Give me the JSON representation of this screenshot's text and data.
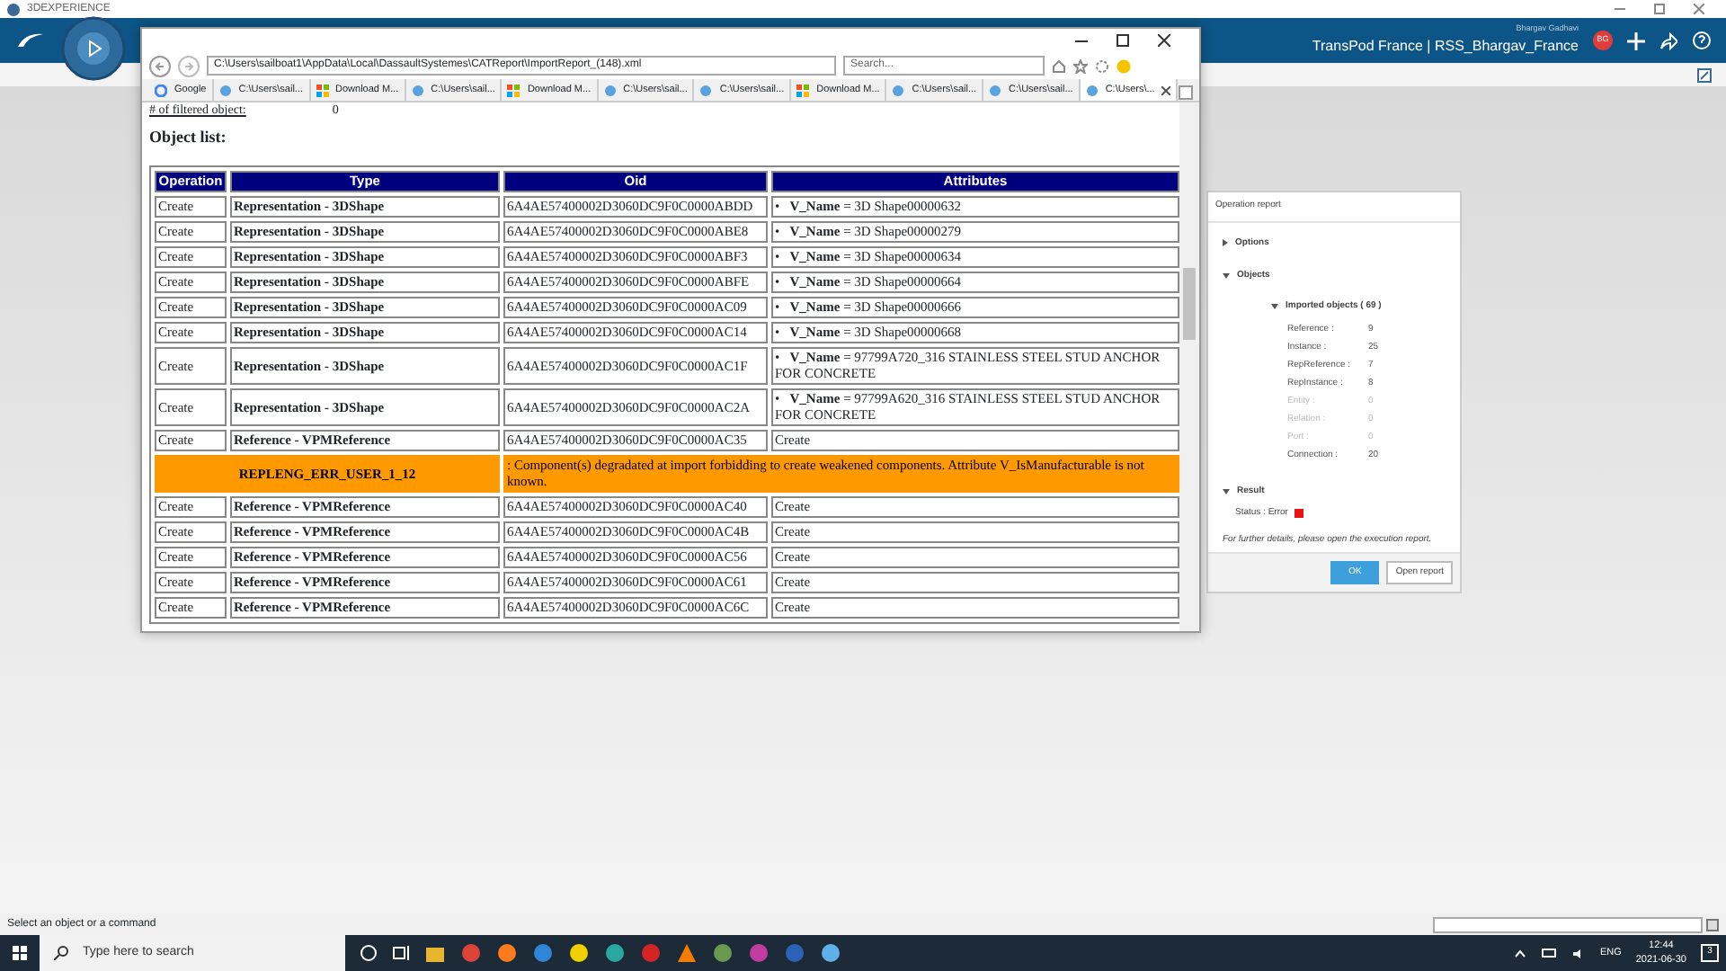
{
  "app_window": {
    "title": "3DEXPERIENCE"
  },
  "header": {
    "user_name": "Bhargav Gadhavi",
    "context": "TransPod France | RSS_Bhargav_France",
    "avatar_initials": "BG"
  },
  "browser": {
    "address": "C:\\Users\\sailboat1\\AppData\\Local\\DassaultSystemes\\CATReport\\ImportReport_(148).xml",
    "search_placeholder": "Search...",
    "tabs": [
      {
        "label": "Google",
        "kind": "google",
        "selected": false
      },
      {
        "label": "C:\\Users\\sail...",
        "kind": "ie",
        "selected": false
      },
      {
        "label": "Download M...",
        "kind": "ms",
        "selected": false
      },
      {
        "label": "C:\\Users\\sail...",
        "kind": "ie",
        "selected": false
      },
      {
        "label": "Download M...",
        "kind": "ms",
        "selected": false
      },
      {
        "label": "C:\\Users\\sail...",
        "kind": "ie",
        "selected": false
      },
      {
        "label": "C:\\Users\\sail...",
        "kind": "ie",
        "selected": false
      },
      {
        "label": "Download M...",
        "kind": "ms",
        "selected": false
      },
      {
        "label": "C:\\Users\\sail...",
        "kind": "ie",
        "selected": false
      },
      {
        "label": "C:\\Users\\sail...",
        "kind": "ie",
        "selected": false
      },
      {
        "label": "C:\\Users\\...",
        "kind": "ie",
        "selected": true
      }
    ],
    "page": {
      "filtered_label": "# of filtered object:",
      "filtered_value": "0",
      "heading": "Object list:",
      "columns": [
        "Operation",
        "Type",
        "Oid",
        "Attributes"
      ],
      "rows": [
        {
          "kind": "item",
          "operation": "Create",
          "type": "Representation - 3DShape",
          "oid": "6A4AE57400002D3060DC9F0C0000ABDD",
          "attributes": "•   **V_Name** = 3D Shape00000632"
        },
        {
          "kind": "item",
          "operation": "Create",
          "type": "Representation - 3DShape",
          "oid": "6A4AE57400002D3060DC9F0C0000ABE8",
          "attributes": "•   **V_Name** = 3D Shape00000279"
        },
        {
          "kind": "item",
          "operation": "Create",
          "type": "Representation - 3DShape",
          "oid": "6A4AE57400002D3060DC9F0C0000ABF3",
          "attributes": "•   **V_Name** = 3D Shape00000634"
        },
        {
          "kind": "item",
          "operation": "Create",
          "type": "Representation - 3DShape",
          "oid": "6A4AE57400002D3060DC9F0C0000ABFE",
          "attributes": "•   **V_Name** = 3D Shape00000664"
        },
        {
          "kind": "item",
          "operation": "Create",
          "type": "Representation - 3DShape",
          "oid": "6A4AE57400002D3060DC9F0C0000AC09",
          "attributes": "•   **V_Name** = 3D Shape00000666"
        },
        {
          "kind": "item",
          "operation": "Create",
          "type": "Representation - 3DShape",
          "oid": "6A4AE57400002D3060DC9F0C0000AC14",
          "attributes": "•   **V_Name** = 3D Shape00000668"
        },
        {
          "kind": "item",
          "operation": "Create",
          "type": "Representation - 3DShape",
          "oid": "6A4AE57400002D3060DC9F0C0000AC1F",
          "attributes": "•   **V_Name** = 97799A720_316 STAINLESS STEEL STUD ANCHOR FOR CONCRETE"
        },
        {
          "kind": "item",
          "operation": "Create",
          "type": "Representation - 3DShape",
          "oid": "6A4AE57400002D3060DC9F0C0000AC2A",
          "attributes": "•   **V_Name** = 97799A620_316 STAINLESS STEEL STUD ANCHOR FOR CONCRETE"
        },
        {
          "kind": "item",
          "operation": "Create",
          "type": "Reference - VPMReference",
          "oid": "6A4AE57400002D3060DC9F0C0000AC35",
          "attributes": "Create"
        },
        {
          "kind": "error",
          "code": "REPLENG_ERR_USER_1_12",
          "message": ": Component(s) degradated at import forbidding to create weakened components. Attribute V_IsManufacturable is not known."
        },
        {
          "kind": "item",
          "operation": "Create",
          "type": "Reference - VPMReference",
          "oid": "6A4AE57400002D3060DC9F0C0000AC40",
          "attributes": "Create"
        },
        {
          "kind": "item",
          "operation": "Create",
          "type": "Reference - VPMReference",
          "oid": "6A4AE57400002D3060DC9F0C0000AC4B",
          "attributes": "Create"
        },
        {
          "kind": "item",
          "operation": "Create",
          "type": "Reference - VPMReference",
          "oid": "6A4AE57400002D3060DC9F0C0000AC56",
          "attributes": "Create"
        },
        {
          "kind": "item",
          "operation": "Create",
          "type": "Reference - VPMReference",
          "oid": "6A4AE57400002D3060DC9F0C0000AC61",
          "attributes": "Create"
        },
        {
          "kind": "item",
          "operation": "Create",
          "type": "Reference - VPMReference",
          "oid": "6A4AE57400002D3060DC9F0C0000AC6C",
          "attributes": "Create"
        }
      ]
    }
  },
  "operation_report": {
    "title": "Operation report",
    "options": {
      "label": "Options",
      "expanded": false
    },
    "objects": {
      "label": "Objects",
      "expanded": true,
      "group": {
        "label": "Imported objects ( 69 )",
        "expanded": true,
        "rows": [
          {
            "label": "Reference :",
            "value": "9",
            "disabled": false
          },
          {
            "label": "Instance :",
            "value": "25",
            "disabled": false
          },
          {
            "label": "RepReference :",
            "value": "7",
            "disabled": false
          },
          {
            "label": "RepInstance :",
            "value": "8",
            "disabled": false
          },
          {
            "label": "Entity :",
            "value": "0",
            "disabled": true
          },
          {
            "label": "Relation :",
            "value": "0",
            "disabled": true
          },
          {
            "label": "Port :",
            "value": "0",
            "disabled": true
          },
          {
            "label": "Connection :",
            "value": "20",
            "disabled": false
          }
        ]
      }
    },
    "result": {
      "label": "Result",
      "expanded": true,
      "status": "Status : Error",
      "color": "#ee1111"
    },
    "note": "For further details, please open the execution report.",
    "buttons": [
      "OK",
      "Open report"
    ]
  },
  "status_bar": {
    "prompt": "Select an object or a command"
  },
  "taskbar": {
    "search_placeholder": "Type here to search",
    "language": "ENG",
    "time": "12:44",
    "date": "2021-06-30",
    "notification_count": "3"
  }
}
